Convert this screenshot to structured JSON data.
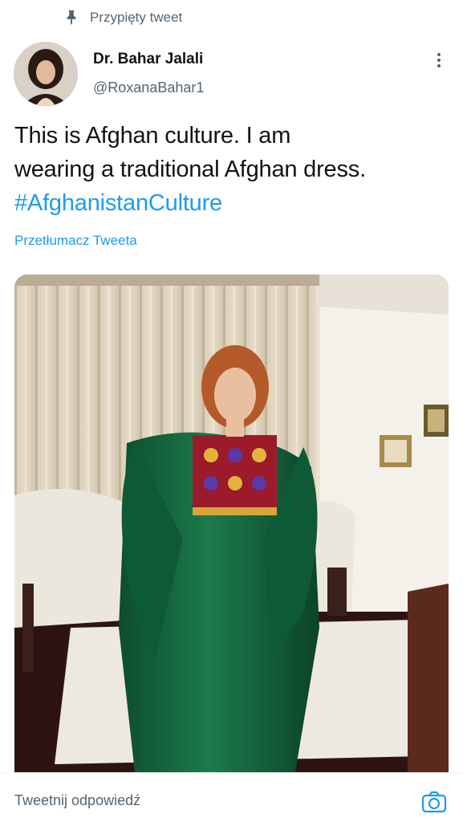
{
  "pinned": {
    "label": "Przypięty tweet",
    "icon": "pin-icon"
  },
  "author": {
    "name": "Dr. Bahar Jalali",
    "handle": "@RoxanaBahar1"
  },
  "tweet": {
    "text_line1": "This is Afghan culture. I am",
    "text_line2": "wearing a traditional Afghan dress.",
    "hashtag": "#AfghanistanCulture"
  },
  "translate_label": "Przetłumacz Tweeta",
  "reply": {
    "placeholder": "Tweetnij odpowiedź",
    "camera_icon": "camera-icon"
  },
  "colors": {
    "link": "#1d9bf0",
    "secondary_text": "#536471",
    "primary_text": "#0f1419"
  }
}
